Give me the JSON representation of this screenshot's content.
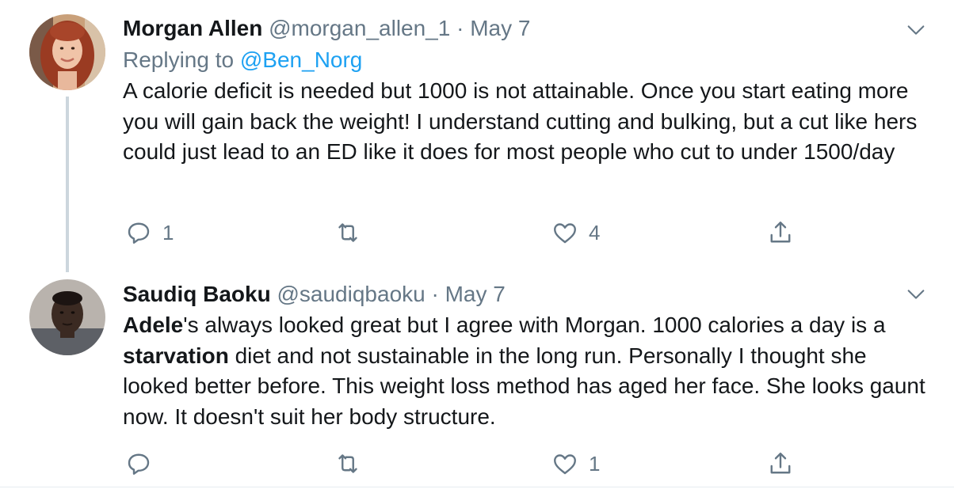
{
  "tweets": [
    {
      "display_name": "Morgan Allen",
      "handle": "@morgan_allen_1",
      "separator": "·",
      "date": "May 7",
      "replying_prefix": "Replying to ",
      "replying_to": "@Ben_Norg",
      "body": "A calorie deficit is needed but 1000 is not attainable. Once you start eating more you will gain back the weight! I understand cutting and bulking, but a cut like hers could just lead to an ED like it does for most people who cut to under 1500/day",
      "reply_count": "1",
      "retweet_count": "",
      "like_count": "4"
    },
    {
      "display_name": "Saudiq Baoku",
      "handle": "@saudiqbaoku",
      "separator": "·",
      "date": "May 7",
      "body_parts": {
        "bold_1": "Adele",
        "text_1": "'s always looked great but I agree with Morgan. 1000 calories a day is a ",
        "bold_2": "starvation",
        "text_2": " diet and not sustainable in the long run. Personally I thought she looked better before. This weight loss method has aged her face. She looks gaunt now. It doesn't suit her body structure."
      },
      "reply_count": "",
      "retweet_count": "",
      "like_count": "1"
    }
  ],
  "icons": {
    "reply": "reply-icon",
    "retweet": "retweet-icon",
    "like": "heart-icon",
    "share": "share-icon",
    "more": "chevron-down-icon"
  },
  "colors": {
    "text": "#14171a",
    "secondary": "#657786",
    "link": "#1da1f2",
    "thread_line": "#ccd6dd"
  }
}
